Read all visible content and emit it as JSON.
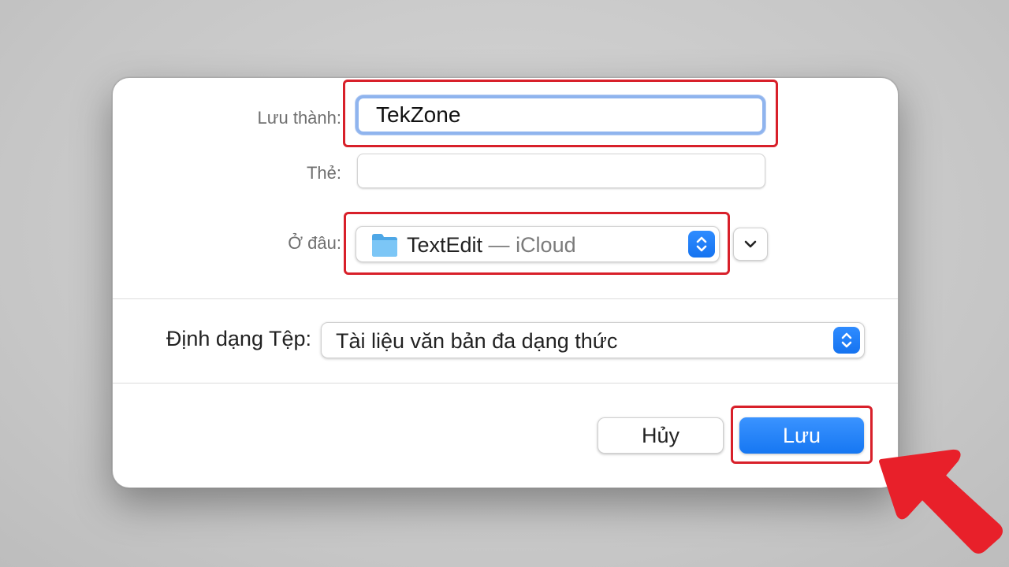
{
  "dialog": {
    "save_as_label": "Lưu thành:",
    "save_as_value": "TekZone",
    "tags_label": "Thẻ:",
    "tags_value": "",
    "where_label": "Ở đâu:",
    "where_app": "TextEdit",
    "where_separator": " — ",
    "where_location": "iCloud",
    "file_format_label": "Định dạng Tệp:",
    "file_format_value": "Tài liệu văn bản đa dạng thức",
    "cancel_label": "Hủy",
    "save_label": "Lưu"
  },
  "icons": {
    "folder": "folder-icon",
    "stepper": "up-down-chevron-icon",
    "expand": "chevron-down-icon",
    "arrow": "red-arrow-pointer"
  },
  "colors": {
    "accent": "#1677f2",
    "highlight": "#d8202a",
    "focus_ring": "#8fb4ee"
  }
}
